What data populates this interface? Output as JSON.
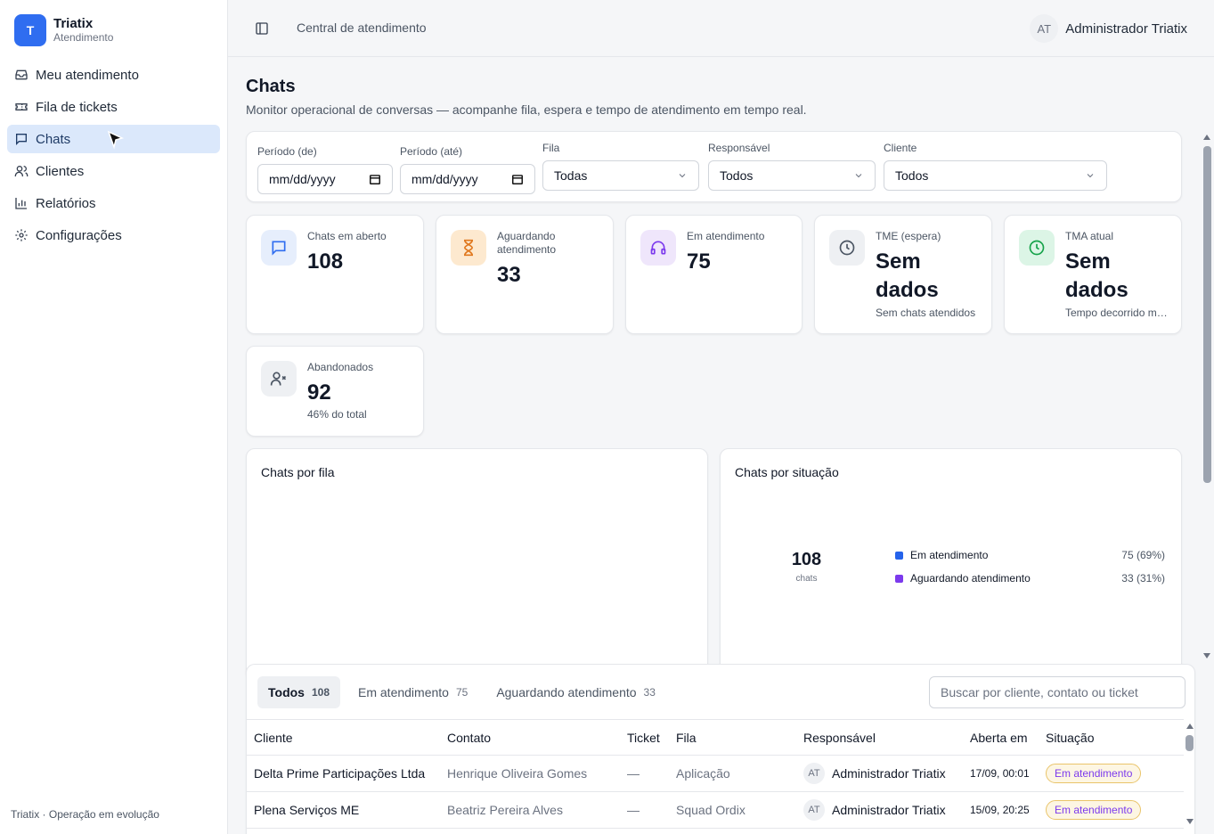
{
  "brand": {
    "logo_letter": "T",
    "name": "Triatix",
    "subtitle": "Atendimento"
  },
  "sidebar": {
    "items": [
      {
        "label": "Meu atendimento",
        "icon": "inbox-icon"
      },
      {
        "label": "Fila de tickets",
        "icon": "ticket-icon"
      },
      {
        "label": "Chats",
        "icon": "chat-icon",
        "active": true
      },
      {
        "label": "Clientes",
        "icon": "users-icon"
      },
      {
        "label": "Relatórios",
        "icon": "bar-chart-icon"
      },
      {
        "label": "Configurações",
        "icon": "gear-icon"
      }
    ],
    "footer": "Triatix · Operação em evolução"
  },
  "header": {
    "breadcrumb": "Central de atendimento",
    "user_initials": "AT",
    "user_name": "Administrador Triatix"
  },
  "page": {
    "title": "Chats",
    "subtitle": "Monitor operacional de conversas — acompanhe fila, espera e tempo de atendimento em tempo real."
  },
  "filters": {
    "period_from": {
      "label": "Período (de)",
      "value": "mm/dd/yyyy"
    },
    "period_to": {
      "label": "Período (até)",
      "value": "mm/dd/yyyy"
    },
    "queue": {
      "label": "Fila",
      "value": "Todas"
    },
    "owner": {
      "label": "Responsável",
      "value": "Todos"
    },
    "client": {
      "label": "Cliente",
      "value": "Todos"
    }
  },
  "stats": [
    {
      "label": "Chats em aberto",
      "value": "108",
      "note": "",
      "icon": "chat-icon",
      "color": "#2f6df0",
      "bg": "#e6eefc"
    },
    {
      "label": "Aguardando atendimento",
      "value": "33",
      "note": "",
      "icon": "hourglass-icon",
      "color": "#e0781e",
      "bg": "#fde9cf"
    },
    {
      "label": "Em atendimento",
      "value": "75",
      "note": "",
      "icon": "headphones-icon",
      "color": "#7c3aed",
      "bg": "#efe6fb"
    },
    {
      "label": "TME (espera)",
      "value": "Sem dados",
      "note": "Sem chats atendidos",
      "icon": "clock-icon",
      "color": "#4b5563",
      "bg": "#eef0f3"
    },
    {
      "label": "TMA atual",
      "value": "Sem dados",
      "note": "Tempo decorrido médio",
      "icon": "clock-icon",
      "color": "#16a34a",
      "bg": "#dcf5e6"
    },
    {
      "label": "Abandonados",
      "value": "92",
      "note": "46% do total",
      "icon": "user-x-icon",
      "color": "#4b5563",
      "bg": "#eef0f3"
    }
  ],
  "panels": {
    "by_queue_title": "Chats por fila",
    "by_status_title": "Chats por situação",
    "donut_total": "108",
    "donut_unit": "chats",
    "legend": [
      {
        "label": "Em atendimento",
        "value": "75 (69%)",
        "color": "#2563eb"
      },
      {
        "label": "Aguardando atendimento",
        "value": "33 (31%)",
        "color": "#7c3aed"
      }
    ]
  },
  "table": {
    "tabs": [
      {
        "label": "Todos",
        "count": "108",
        "active": true
      },
      {
        "label": "Em atendimento",
        "count": "75"
      },
      {
        "label": "Aguardando atendimento",
        "count": "33"
      }
    ],
    "search_placeholder": "Buscar por cliente, contato ou ticket",
    "columns": [
      "Cliente",
      "Contato",
      "Ticket",
      "Fila",
      "Responsável",
      "Aberta em",
      "Situação"
    ],
    "rows": [
      {
        "cliente": "Delta Prime Participações Ltda",
        "contato": "Henrique Oliveira Gomes",
        "ticket": "—",
        "fila": "Aplicação",
        "resp_initials": "AT",
        "resp": "Administrador Triatix",
        "aberta": "17/09, 00:01",
        "situacao": "Em atendimento"
      },
      {
        "cliente": "Plena Serviços ME",
        "contato": "Beatriz Pereira Alves",
        "ticket": "—",
        "fila": "Squad Ordix",
        "resp_initials": "AT",
        "resp": "Administrador Triatix",
        "aberta": "15/09, 20:25",
        "situacao": "Em atendimento"
      }
    ]
  }
}
